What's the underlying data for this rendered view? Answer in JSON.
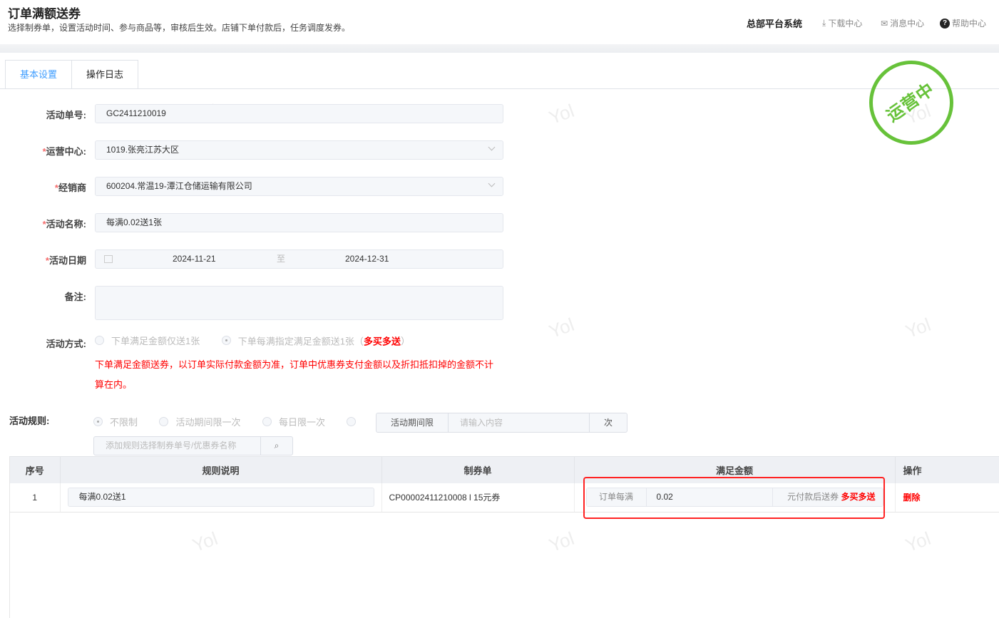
{
  "header": {
    "title": "订单满额送券",
    "subtitle": "选择制券单，设置活动时间、参与商品等，审核后生效。店铺下单付款后，任务调度发券。",
    "system": "总部平台系统",
    "download": "下载中心",
    "messages": "消息中心",
    "help": "帮助中心"
  },
  "tabs": [
    "基本设置",
    "操作日志"
  ],
  "stamp": "运营中",
  "watermark": "Yol",
  "form": {
    "order_no": {
      "label": "活动单号:",
      "value": "GC2411210019"
    },
    "center": {
      "label": "运营中心:",
      "value": "1019.张亮江苏大区"
    },
    "dealer": {
      "label": "经销商",
      "value": "600204.常温19-潭江仓储运输有限公司"
    },
    "name": {
      "label": "活动名称:",
      "value": "每满0.02送1张"
    },
    "date": {
      "label": "活动日期",
      "start": "2024-11-21",
      "sep": "至",
      "end": "2024-12-31"
    },
    "remark": {
      "label": "备注:",
      "value": ""
    },
    "mode": {
      "label": "活动方式:",
      "option1": "下单满足金额仅送1张",
      "option2": "下单每满指定满足金额送1张（",
      "option2_tag": "多买多送",
      "option2_end": "）",
      "note": "下单满足金额送券，以订单实际付款金额为准，订单中优惠券支付金额以及折扣抵扣掉的金额不计算在内。"
    },
    "rules": {
      "label": "活动规则:",
      "opt1": "不限制",
      "opt2": "活动期间限一次",
      "opt3": "每日限一次",
      "prefix": "活动期间限",
      "placeholder": "请输入内容",
      "suffix": "次",
      "search_placeholder": "添加规则选择制券单号/优惠券名称"
    }
  },
  "table": {
    "headers": [
      "序号",
      "规则说明",
      "制券单",
      "满足金额",
      "操作"
    ],
    "rows": [
      {
        "index": "1",
        "desc": "每满0.02送1",
        "coupon": "CP00002411210008 l 15元券",
        "prefix": "订单每满",
        "amount": "0.02",
        "suffix": "元付款后送券",
        "tag": "多买多送",
        "action": "删除"
      }
    ]
  }
}
